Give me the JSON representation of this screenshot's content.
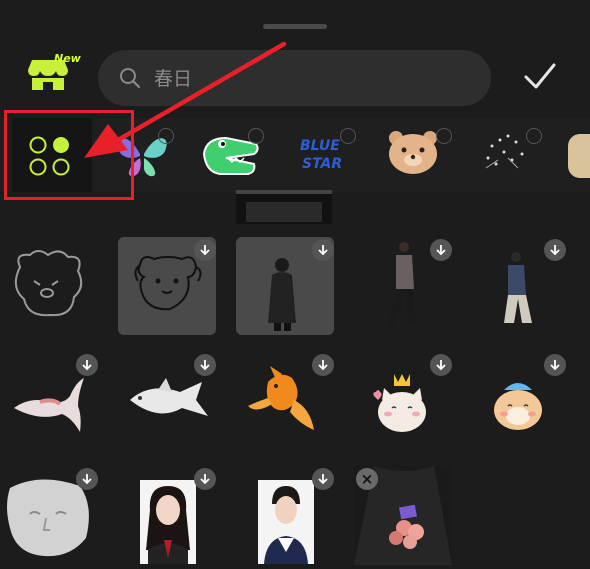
{
  "search": {
    "placeholder": "春日"
  },
  "header": {
    "new_badge": "New"
  },
  "categories": [
    {
      "name": "all",
      "icon": "grid-dots-icon"
    },
    {
      "name": "butterfly-sticker",
      "icon": "butterfly-icon"
    },
    {
      "name": "crocodile-sticker",
      "icon": "crocodile-icon"
    },
    {
      "name": "blue-star-sticker",
      "icon": "text-sticker-icon",
      "text_line1": "BLUE",
      "text_line2": "STAR"
    },
    {
      "name": "bear-sticker",
      "icon": "bear-icon"
    },
    {
      "name": "sparkle-sticker",
      "icon": "sparkle-icon"
    }
  ],
  "colors": {
    "accent": "#c6f03a",
    "highlight": "#e8202a",
    "background": "#1c1c1c",
    "tile": "#4a4a4a"
  },
  "stickers": [
    {
      "name": "line-dog"
    },
    {
      "name": "doodle-dog"
    },
    {
      "name": "man-in-black-coat"
    },
    {
      "name": "walking-man"
    },
    {
      "name": "walking-woman"
    },
    {
      "name": "koi-fish"
    },
    {
      "name": "white-fish"
    },
    {
      "name": "goldfish"
    },
    {
      "name": "crown-cat"
    },
    {
      "name": "hat-cat"
    },
    {
      "name": "plaster-head"
    },
    {
      "name": "woman-portrait"
    },
    {
      "name": "man-portrait"
    },
    {
      "name": "flowers-photo"
    }
  ]
}
